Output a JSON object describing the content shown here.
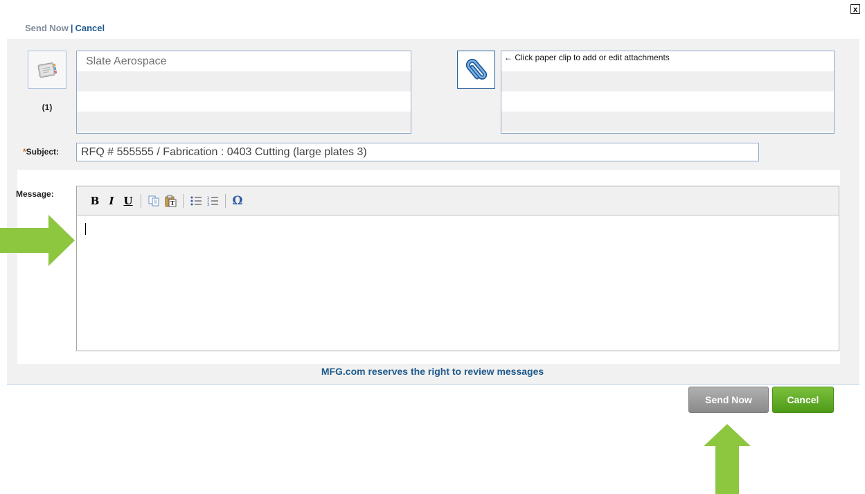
{
  "dialog": {
    "close_glyph": "x"
  },
  "top_links": {
    "send_label": "Send Now",
    "separator": "|",
    "cancel_label": "Cancel"
  },
  "address_book": {
    "icon": "address-book-icon",
    "count_label": "(1)"
  },
  "recipients": {
    "rows": [
      "Slate Aerospace",
      "",
      "",
      ""
    ]
  },
  "attachments": {
    "icon": "paperclip-icon",
    "rows": [
      "← Click paper clip to add or edit attachments",
      "",
      "",
      ""
    ]
  },
  "subject": {
    "required_mark": "*",
    "label": "Subject:",
    "value": "RFQ # 555555 / Fabrication : 0403 Cutting (large plates 3)"
  },
  "message": {
    "label": "Message:",
    "toolbar": {
      "bold": "B",
      "italic": "I",
      "underline": "U",
      "special_char": "Ω"
    },
    "body": ""
  },
  "notice": "MFG.com reserves the right to review messages",
  "buttons": {
    "send_label": "Send Now",
    "cancel_label": "Cancel"
  },
  "colors": {
    "accent_blue": "#1e5a8b",
    "green": "#5aa520",
    "arrow_green": "#8dc63f"
  }
}
